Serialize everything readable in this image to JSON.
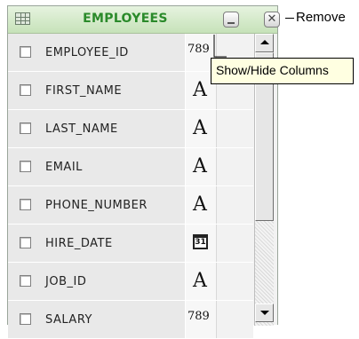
{
  "panel": {
    "title": "EMPLOYEES",
    "remove_label": "Remove",
    "tooltip": "Show/Hide Columns"
  },
  "columns": [
    {
      "name": "EMPLOYEE_ID",
      "type_icon": "number-icon",
      "type_text": "789"
    },
    {
      "name": "FIRST_NAME",
      "type_icon": "text-icon",
      "type_text": "A"
    },
    {
      "name": "LAST_NAME",
      "type_icon": "text-icon",
      "type_text": "A"
    },
    {
      "name": "EMAIL",
      "type_icon": "text-icon",
      "type_text": "A"
    },
    {
      "name": "PHONE_NUMBER",
      "type_icon": "text-icon",
      "type_text": "A"
    },
    {
      "name": "HIRE_DATE",
      "type_icon": "calendar-icon",
      "type_text": "31"
    },
    {
      "name": "JOB_ID",
      "type_icon": "text-icon",
      "type_text": "A"
    },
    {
      "name": "SALARY",
      "type_icon": "number-icon",
      "type_text": "789"
    }
  ],
  "colors": {
    "title": "#2a8a2a",
    "header_bg": "#d4ebca",
    "tooltip_bg": "#ffffe1"
  }
}
